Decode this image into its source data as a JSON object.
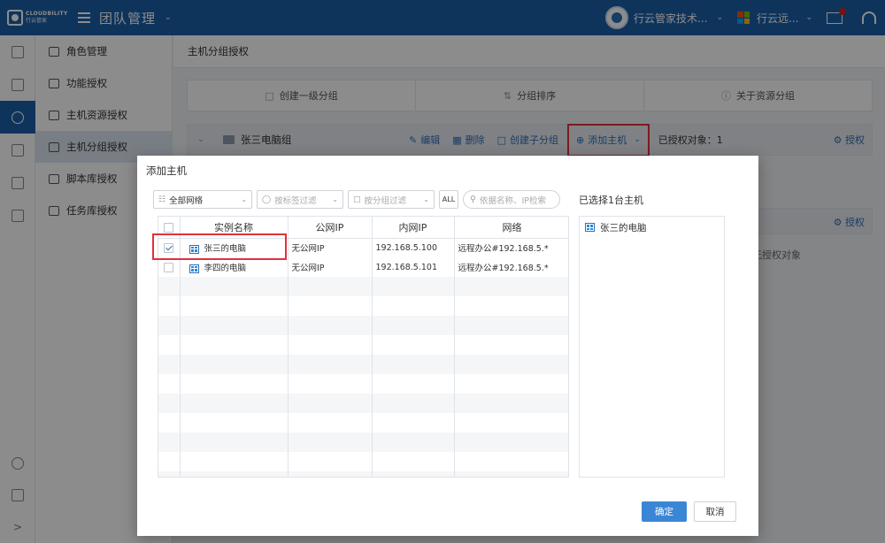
{
  "topbar": {
    "logo_en": "CLOUDBILITY",
    "logo_cn": "行云管家",
    "team_title": "团队管理",
    "user_name": "行云管家技术...",
    "org_name": "行云远...",
    "brand_color": "#1a5fa8"
  },
  "rail": {
    "icons": [
      "document-icon",
      "users-icon",
      "user-auth-icon",
      "resources-icon",
      "clipboard-icon",
      "book-icon"
    ],
    "bottom_icons": [
      "search-icon",
      "task-icon",
      "expand-icon"
    ]
  },
  "submenu": {
    "items": [
      {
        "label": "角色管理",
        "icon": "role-icon"
      },
      {
        "label": "功能授权",
        "icon": "function-icon"
      },
      {
        "label": "主机资源授权",
        "icon": "monitor-icon"
      },
      {
        "label": "主机分组授权",
        "icon": "folder-monitor-icon"
      },
      {
        "label": "脚本库授权",
        "icon": "script-icon"
      },
      {
        "label": "任务库授权",
        "icon": "task-icon"
      }
    ]
  },
  "main": {
    "title": "主机分组授权",
    "group_bar": {
      "create_group": "创建一级分组",
      "sort_group": "分组排序",
      "about_group": "关于资源分组"
    },
    "group_row": {
      "name": "张三电脑组",
      "edit": "编辑",
      "delete": "删除",
      "create_sub": "创建子分组",
      "add_host": "添加主机",
      "auth_count": "已授权对象：1",
      "authorize": "授权"
    },
    "group_row2": {
      "authorize": "授权",
      "unauth": "无授权对象"
    }
  },
  "dialog": {
    "title": "添加主机",
    "filters": {
      "network": "全部网络",
      "tag_filter": "按标签过滤",
      "group_filter": "按分组过滤",
      "all": "ALL",
      "search_placeholder": "依据名称、IP检索"
    },
    "columns": [
      "实例名称",
      "公网IP",
      "内网IP",
      "网络"
    ],
    "rows": [
      {
        "checked": true,
        "name": "张三的电脑",
        "public_ip": "无公网IP",
        "private_ip": "192.168.5.100",
        "network": "远程办公#192.168.5.*"
      },
      {
        "checked": false,
        "name": "李四的电脑",
        "public_ip": "无公网IP",
        "private_ip": "192.168.5.101",
        "network": "远程办公#192.168.5.*"
      }
    ],
    "selected_title": "已选择1台主机",
    "selected_items": [
      "张三的电脑"
    ],
    "ok": "确定",
    "cancel": "取消"
  }
}
